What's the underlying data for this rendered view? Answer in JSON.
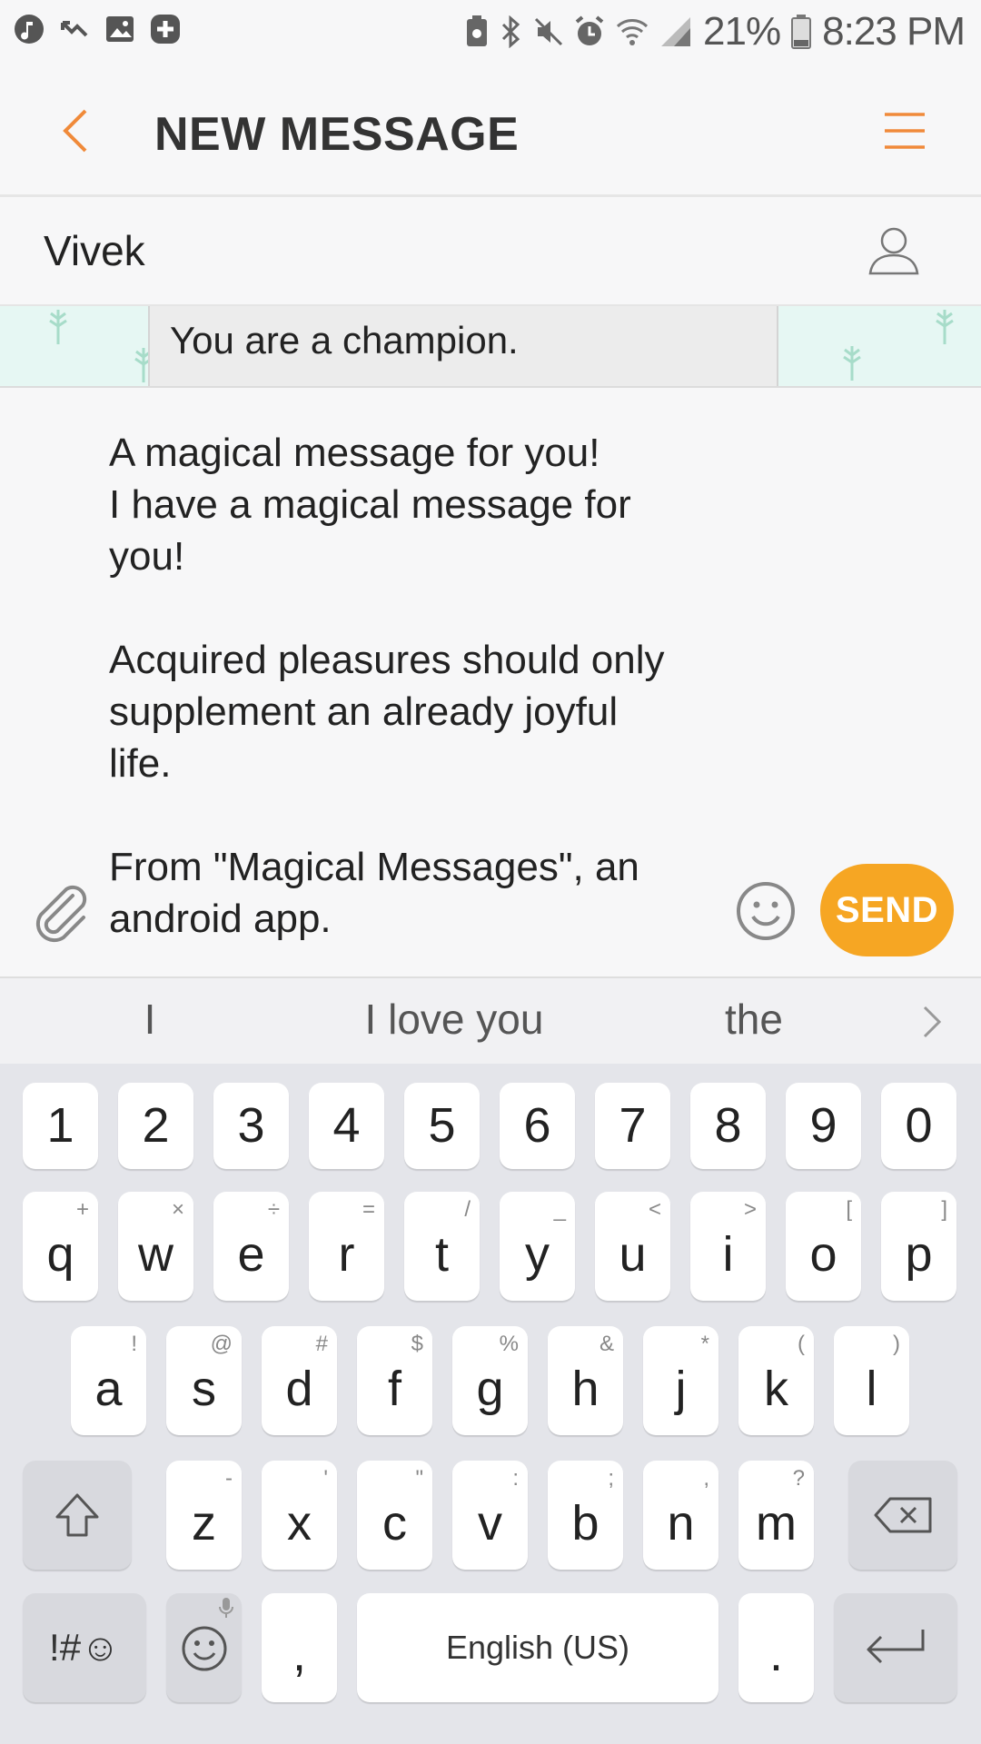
{
  "status_bar": {
    "battery": "21%",
    "time": "8:23 PM"
  },
  "header": {
    "title": "NEW MESSAGE"
  },
  "recipient": {
    "name": "Vivek"
  },
  "bubble": {
    "text": "You are a champion."
  },
  "compose": {
    "text": "A magical message for you!\nI have a magical message for you!\n\nAcquired pleasures should only supplement an already joyful life.\n\nFrom \"Magical Messages\", an android app."
  },
  "send_label": "SEND",
  "suggestions": [
    "I",
    "I love you",
    "the"
  ],
  "keys": {
    "numbers": [
      "1",
      "2",
      "3",
      "4",
      "5",
      "6",
      "7",
      "8",
      "9",
      "0"
    ],
    "row1": [
      [
        "q",
        "+"
      ],
      [
        "w",
        "×"
      ],
      [
        "e",
        "÷"
      ],
      [
        "r",
        "="
      ],
      [
        "t",
        "/"
      ],
      [
        "y",
        "_"
      ],
      [
        "u",
        "<"
      ],
      [
        "i",
        ">"
      ],
      [
        "o",
        "["
      ],
      [
        "p",
        "]"
      ]
    ],
    "row2": [
      [
        "a",
        "!"
      ],
      [
        "s",
        "@"
      ],
      [
        "d",
        "#"
      ],
      [
        "f",
        "$"
      ],
      [
        "g",
        "%"
      ],
      [
        "h",
        "&"
      ],
      [
        "j",
        "*"
      ],
      [
        "k",
        "("
      ],
      [
        "l",
        ")"
      ]
    ],
    "row3": [
      [
        "z",
        "-"
      ],
      [
        "x",
        "'"
      ],
      [
        "c",
        "\""
      ],
      [
        "v",
        ":"
      ],
      [
        "b",
        ";"
      ],
      [
        "n",
        ","
      ],
      [
        "m",
        "?"
      ]
    ],
    "symbols": "!#☺",
    "comma": ",",
    "space": "English (US)",
    "period": "."
  },
  "colors": {
    "accent": "#f6a623",
    "back_arrow": "#f08a3a"
  }
}
